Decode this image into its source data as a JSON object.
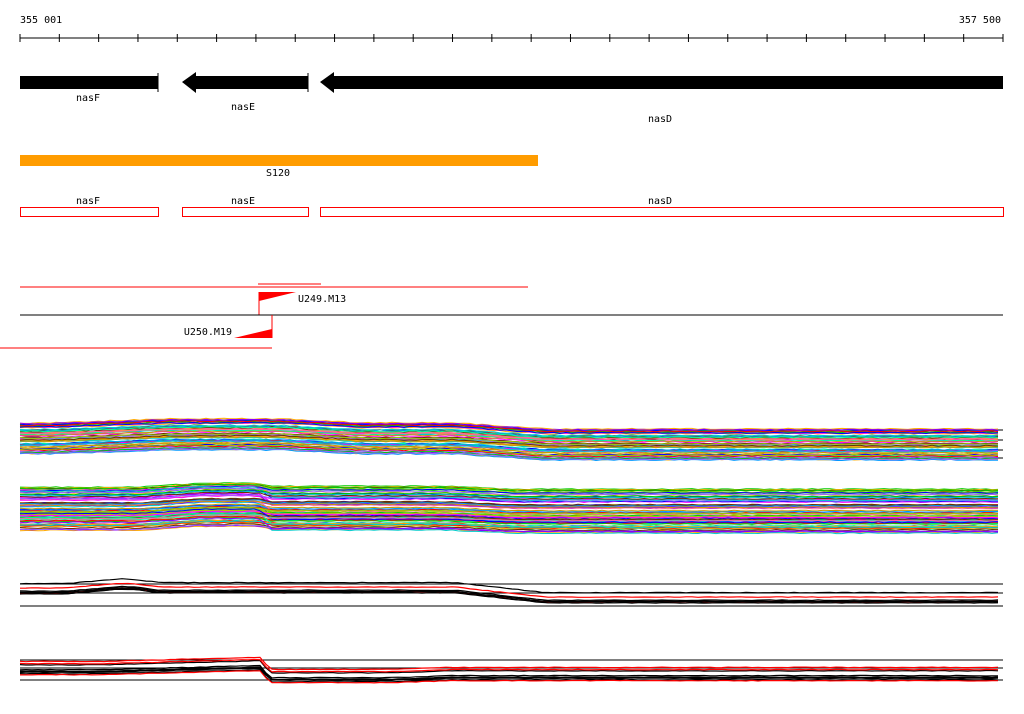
{
  "ruler": {
    "start_label": "355 001",
    "end_label": "357 500",
    "start": 355001,
    "end": 357500
  },
  "genes": [
    {
      "name": "nasF",
      "strand": "+"
    },
    {
      "name": "nasE",
      "strand": "-"
    },
    {
      "name": "nasD",
      "strand": "-"
    }
  ],
  "segment": {
    "label": "S120",
    "color": "#ff9c00"
  },
  "gene_boxes": [
    {
      "name": "nasF"
    },
    {
      "name": "nasE"
    },
    {
      "name": "nasD"
    }
  ],
  "probes": [
    {
      "label": "U249.M13"
    },
    {
      "label": "U250.M19"
    }
  ],
  "colors": {
    "gene_arrow": "#000000",
    "box_outline": "#ff0000",
    "probe": "#ff0000",
    "trace_palette": [
      "#ff00ff",
      "#00cc00",
      "#0000ff",
      "#ffaa00",
      "#00cccc",
      "#ff0000",
      "#8800ff",
      "#99cc00",
      "#ff6699",
      "#663300",
      "#0099ff",
      "#cc9900",
      "#00ff99",
      "#9966ff"
    ]
  }
}
